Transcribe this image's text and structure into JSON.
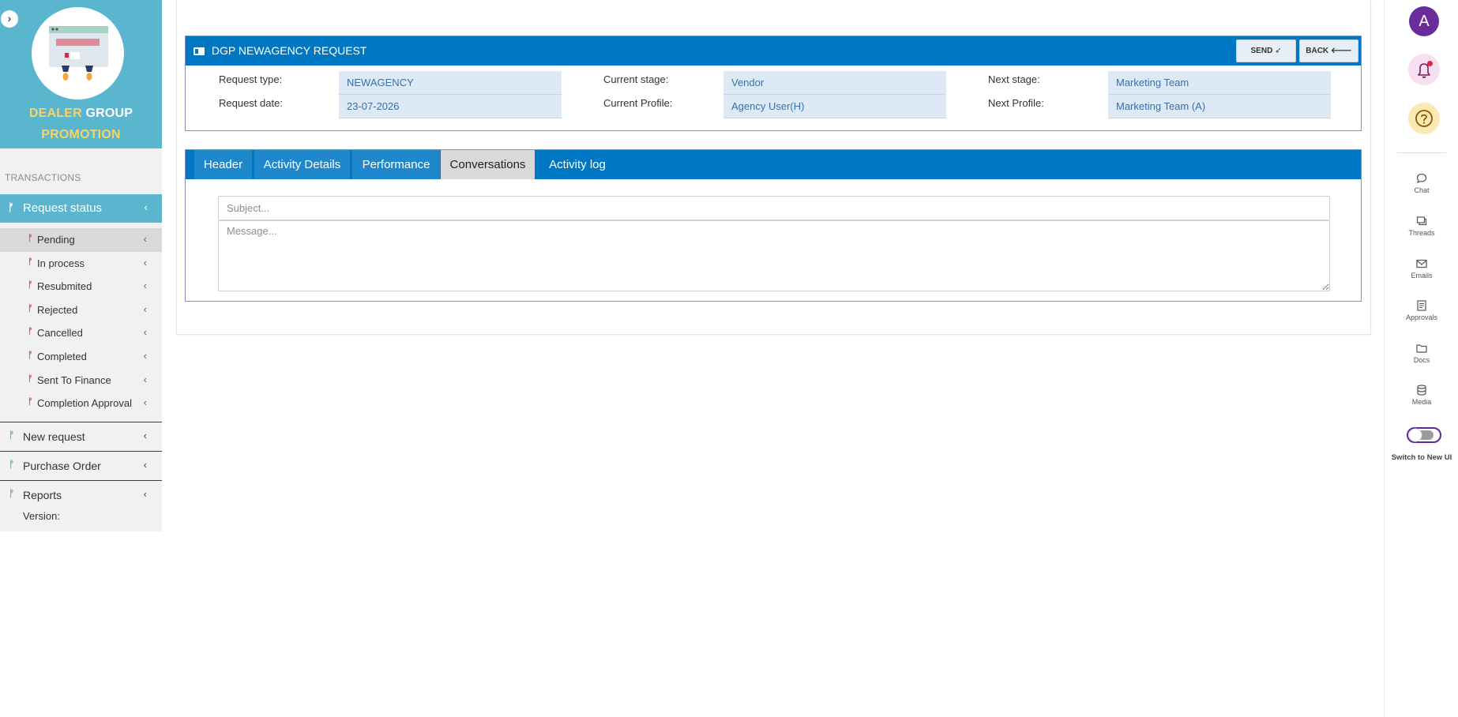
{
  "brand": {
    "line1_a": "DEALER",
    "line1_b": "GROUP",
    "line2": "PROMOTION",
    "collapse_icon": "chevron-right-icon"
  },
  "sidebar": {
    "section_title": "TRANSACTIONS",
    "active_menu": {
      "label": "Request status",
      "icon": "branch-icon"
    },
    "sub_items": [
      {
        "label": "Pending",
        "selected": true
      },
      {
        "label": "In process"
      },
      {
        "label": "Resubmited"
      },
      {
        "label": "Rejected"
      },
      {
        "label": "Cancelled"
      },
      {
        "label": "Completed"
      },
      {
        "label": "Sent To Finance"
      },
      {
        "label": "Completion Approval"
      }
    ],
    "groups": [
      {
        "label": "New request"
      },
      {
        "label": "Purchase Order"
      },
      {
        "label": "Reports"
      }
    ],
    "version_label": "Version:"
  },
  "request": {
    "title": "DGP NEWAGENCY REQUEST",
    "send_label": "SEND",
    "back_label": "BACK",
    "fields": {
      "request_type_label": "Request type:",
      "request_type_value": "NEWAGENCY",
      "request_date_label": "Request date:",
      "request_date_value": "23-07-2026",
      "current_stage_label": "Current stage:",
      "current_stage_value": "Vendor",
      "current_profile_label": "Current Profile:",
      "current_profile_value": "Agency User(H)",
      "next_stage_label": "Next stage:",
      "next_stage_value": "Marketing Team",
      "next_profile_label": "Next Profile:",
      "next_profile_value": "Marketing Team (A)"
    }
  },
  "tabs": {
    "items": [
      "Header",
      "Activity Details",
      "Performance",
      "Conversations",
      "Activity log"
    ],
    "active": "Conversations"
  },
  "conversation": {
    "subject_placeholder": "Subject...",
    "message_placeholder": "Message..."
  },
  "right_rail": {
    "avatar_letter": "A",
    "items": [
      "Chat",
      "Threads",
      "Emails",
      "Approvals",
      "Docs",
      "Media"
    ],
    "toggle_label": "Switch to New UI",
    "accent": "#6a2b9d"
  },
  "colors": {
    "primary_blue": "#0077c2",
    "sidebar_teal": "#5ab5cf",
    "brand_yellow": "#f4d46a",
    "value_bg": "#dde9f4"
  }
}
